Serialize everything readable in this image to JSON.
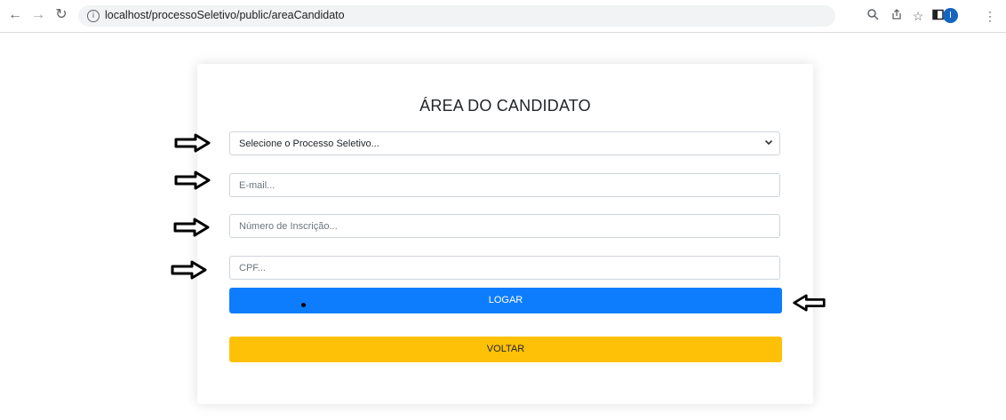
{
  "browser": {
    "url": "localhost/processoSeletivo/public/areaCandidato",
    "profile_initial": "I"
  },
  "form": {
    "title": "ÁREA DO CANDIDATO",
    "process_select": {
      "selected": "Selecione o Processo Seletivo..."
    },
    "email": {
      "placeholder": "E-mail..."
    },
    "inscricao": {
      "placeholder": "Número de Inscrição..."
    },
    "cpf": {
      "placeholder": "CPF..."
    },
    "login_label": "LOGAR",
    "back_label": "VOLTAR"
  },
  "colors": {
    "primary": "#0d7dfd",
    "warning": "#ffc107",
    "annotation_arrow": "#000000"
  }
}
